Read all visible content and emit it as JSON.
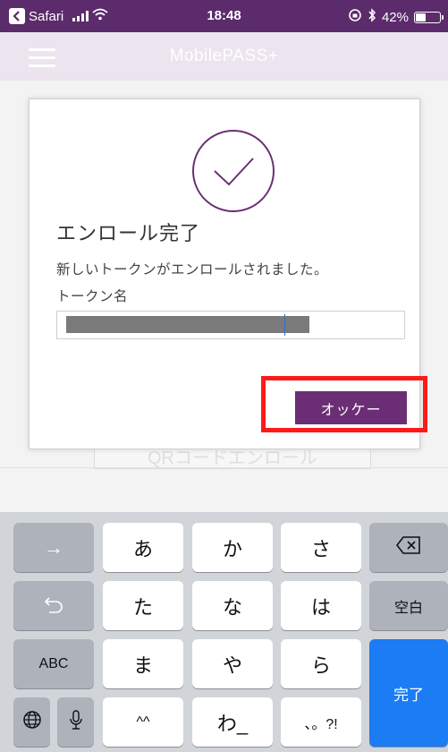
{
  "status_bar": {
    "app": "Safari",
    "time": "18:48",
    "battery": "42%",
    "colors": {
      "background": "#5b2b6b",
      "text": "#ffffff"
    }
  },
  "nav": {
    "title": "MobilePASS+"
  },
  "background": {
    "behind_button_label": "QRコードエンロール"
  },
  "modal": {
    "icon": "check-circle-icon",
    "title": "エンロール完了",
    "message": "新しいトークンがエンロールされました。",
    "token_label": "トークン名",
    "token_value": "",
    "ok_label": "オッケー",
    "accent_color": "#6b2e75",
    "highlight_color": "#ff1a1a"
  },
  "keyboard": {
    "row1": {
      "left": "→",
      "k1": "あ",
      "k2": "か",
      "k3": "さ",
      "right_icon": "backspace-icon"
    },
    "row2": {
      "left_icon": "undo-icon",
      "k1": "た",
      "k2": "な",
      "k3": "は",
      "right": "空白"
    },
    "row3": {
      "left": "ABC",
      "k1": "ま",
      "k2": "や",
      "k3": "ら",
      "right": "完了"
    },
    "row4": {
      "globe_icon": "globe-icon",
      "mic_icon": "microphone-icon",
      "k1": "^^",
      "k2": "わ_",
      "k3": "、。?!"
    },
    "done_color": "#1b7cf3"
  }
}
